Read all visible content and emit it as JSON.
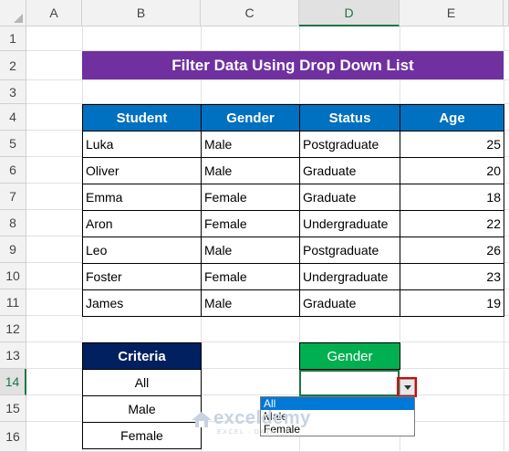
{
  "columns": [
    "A",
    "B",
    "C",
    "D",
    "E"
  ],
  "rows": [
    "1",
    "2",
    "3",
    "4",
    "5",
    "6",
    "7",
    "8",
    "9",
    "10",
    "11",
    "12",
    "13",
    "14",
    "15",
    "16"
  ],
  "selected_column": "D",
  "selected_row": "14",
  "title": "Filter Data Using Drop Down List",
  "table": {
    "headers": [
      "Student",
      "Gender",
      "Status",
      "Age"
    ],
    "rows": [
      [
        "Luka",
        "Male",
        "Postgraduate",
        "25"
      ],
      [
        "Oliver",
        "Male",
        "Graduate",
        "20"
      ],
      [
        "Emma",
        "Female",
        "Graduate",
        "18"
      ],
      [
        "Aron",
        "Female",
        "Undergraduate",
        "22"
      ],
      [
        "Leo",
        "Male",
        "Postgraduate",
        "26"
      ],
      [
        "Foster",
        "Female",
        "Undergraduate",
        "23"
      ],
      [
        "James",
        "Male",
        "Graduate",
        "19"
      ]
    ]
  },
  "criteria": {
    "header": "Criteria",
    "items": [
      "All",
      "Male",
      "Female"
    ]
  },
  "gender_filter": {
    "header": "Gender",
    "value": "",
    "options": [
      "All",
      "Male",
      "Female"
    ],
    "highlighted": "All"
  },
  "watermark": {
    "brand": "exceldemy",
    "tagline": "EXCEL · DATA · BI"
  },
  "colors": {
    "title_bg": "#7030a0",
    "table_header_bg": "#0070c0",
    "criteria_header_bg": "#002060",
    "gender_header_bg": "#00b050",
    "selection_green": "#217346",
    "highlight_red": "#e00000"
  }
}
